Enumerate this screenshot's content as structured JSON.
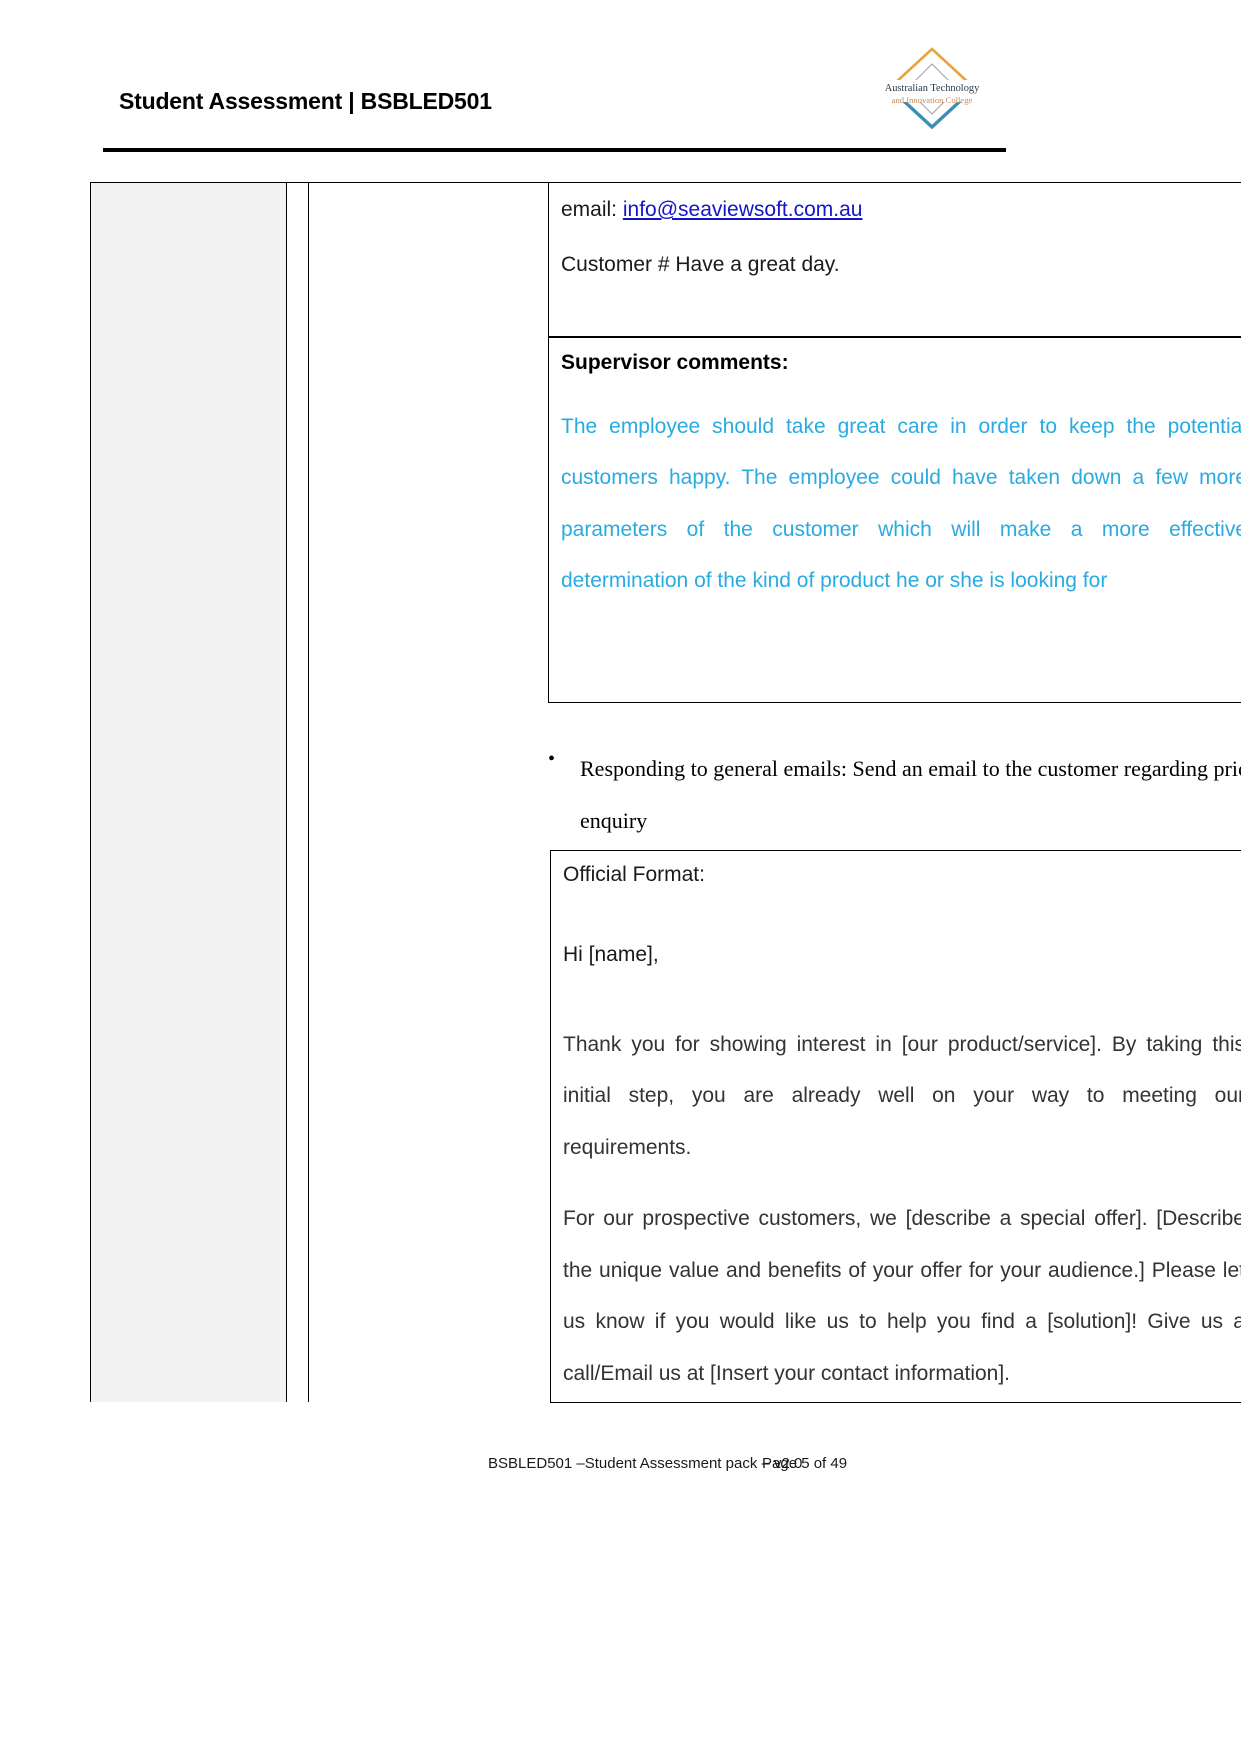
{
  "header": {
    "title": "Student Assessment | BSBLED501",
    "logo": {
      "line1": "Australian Technology",
      "line2": "and Innovation College",
      "top_chevron_color": "#E8A33D",
      "bottom_chevron_color": "#3B8FB5",
      "diamond_color": "#9aa3ab",
      "line1_color": "#2b3a4a",
      "line2_color": "#C98A5E"
    }
  },
  "email_block": {
    "label": "email: ",
    "link_text": "info@seaviewsoft.com.au",
    "link_color": "#1414cc",
    "closing": "Customer # Have a great day."
  },
  "supervisor": {
    "heading": "Supervisor comments:",
    "comment_color": "#29ABE2",
    "comment": "The employee should take great care in order to keep the potential customers happy. The employee could have taken down a few more parameters of the customer which will make a more effective determination of the kind of product he or she is looking for"
  },
  "bullet": {
    "marker": "•",
    "text": "Responding to general emails: Send an email to the customer regarding price",
    "text_last_line": "enquiry"
  },
  "official_format": {
    "label": "Official Format:",
    "greeting": "Hi [name],",
    "paragraphs": [
      "Thank you for showing interest in [our product/service]. By taking this initial step, you are already well on your way to meeting our requirements.",
      "For our prospective customers, we [describe a special offer]. [Describe the unique value and benefits of your offer for your audience.]  Please let us know if you would like us to help you find a [solution]! Give us a call/Email us at [Insert your contact information]."
    ]
  },
  "footer": {
    "left": "BSBLED501 –Student Assessment pack – v2.0",
    "right": "Page 5 of 49"
  }
}
